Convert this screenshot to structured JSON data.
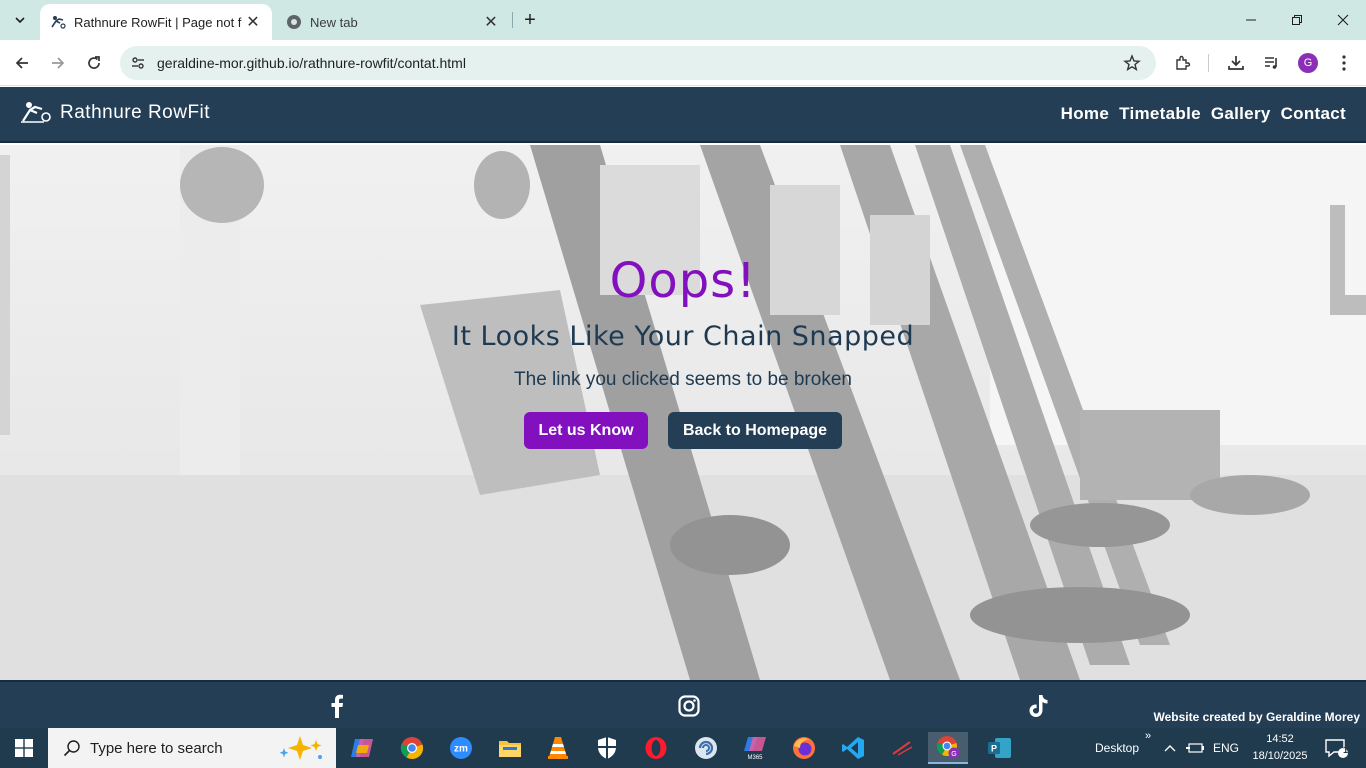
{
  "browser": {
    "tabs": [
      {
        "title": "Rathnure RowFit | Page not found",
        "active": true
      },
      {
        "title": "New tab",
        "active": false
      }
    ],
    "url": "geraldine-mor.github.io/rathnure-rowfit/contat.html",
    "profile_initial": "G"
  },
  "site": {
    "brand": "Rathnure RowFit",
    "nav": [
      "Home",
      "Timetable",
      "Gallery",
      "Contact"
    ]
  },
  "hero": {
    "heading": "Oops!",
    "subheading": "It Looks Like Your Chain Snapped",
    "description": "The link you clicked seems to be broken",
    "primary_button": "Let us Know",
    "secondary_button": "Back to Homepage"
  },
  "footer": {
    "social": [
      "facebook-icon",
      "instagram-icon",
      "tiktok-icon"
    ],
    "credit": "Website created by Geraldine Morey"
  },
  "taskbar": {
    "search_placeholder": "Type here to search",
    "desktop_label": "Desktop",
    "language": "ENG",
    "time": "14:52",
    "date": "18/10/2025",
    "notification_count": "1"
  },
  "colors": {
    "brand_navy": "#233e55",
    "accent_purple": "#8310bf",
    "chrome_tabstrip": "#cfe8e4"
  }
}
